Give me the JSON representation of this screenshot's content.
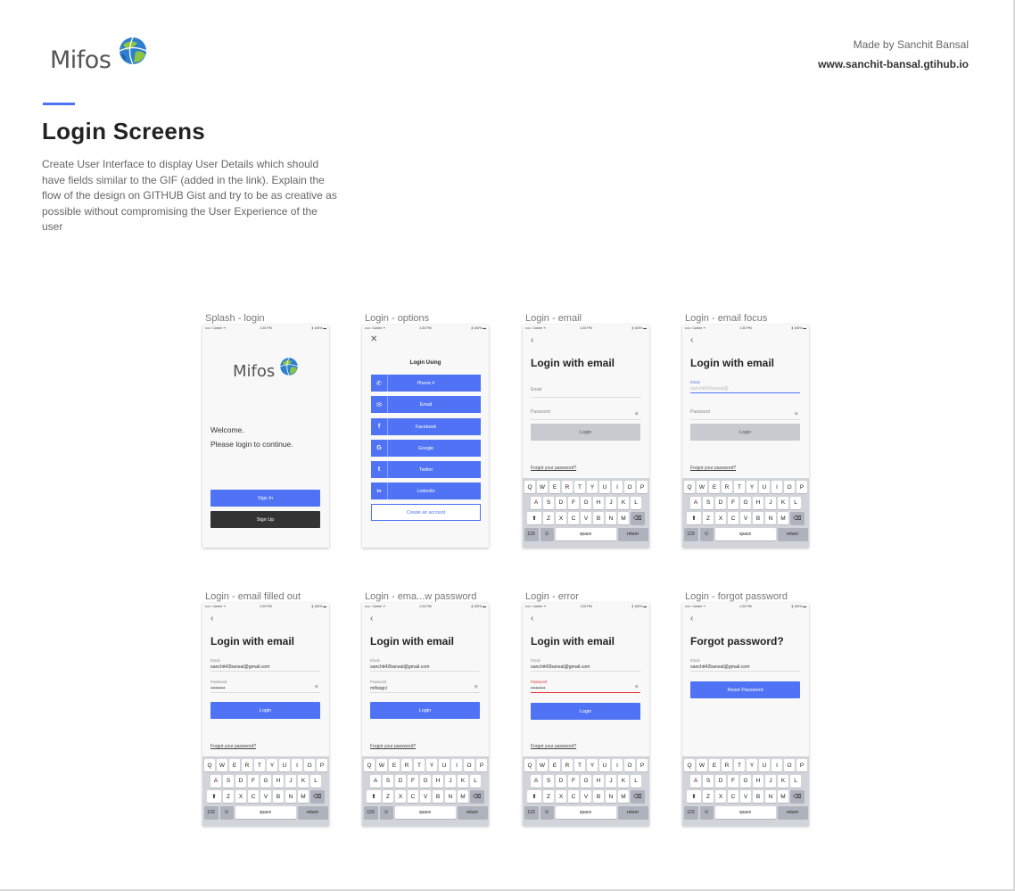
{
  "header": {
    "brand": "Mifos",
    "made_by": "Made by Sanchit Bansal",
    "website": "www.sanchit-bansal.gtihub.io"
  },
  "page_title": "Login Screens",
  "description": "Create User Interface to display User Details which should have fields similar to the GIF (added in the link). Explain the flow of the design on GITHUB Gist and try to be as creative as possible without compromising the User Experience of the user",
  "colors": {
    "accent": "#4f73f4",
    "dark_button": "#333333",
    "error": "#e53935"
  },
  "status_bar": {
    "carrier": "••••○ Carrier ᯤ",
    "time": "1:20 PM",
    "battery": "∦ 100% ▬"
  },
  "keyboard": {
    "row1": [
      "Q",
      "W",
      "E",
      "R",
      "T",
      "Y",
      "U",
      "I",
      "O",
      "P"
    ],
    "row2": [
      "A",
      "S",
      "D",
      "F",
      "G",
      "H",
      "J",
      "K",
      "L"
    ],
    "row3": [
      "Z",
      "X",
      "C",
      "V",
      "B",
      "N",
      "M"
    ],
    "shift": "⬆",
    "backspace": "⌫",
    "numbers": "123",
    "emoji": "☺",
    "space": "space",
    "return": "return"
  },
  "screens": {
    "splash": {
      "label": "Splash - login",
      "brand": "Mifos",
      "welcome_line1": "Welcome.",
      "welcome_line2": "Please login to continue.",
      "sign_in": "Sign In",
      "sign_up": "Sign Up"
    },
    "options": {
      "label": "Login - options",
      "close": "✕",
      "title": "Login Using",
      "buttons": [
        {
          "icon": "phone-icon",
          "glyph": "✆",
          "label": "Phone #"
        },
        {
          "icon": "mail-icon",
          "glyph": "✉",
          "label": "Email"
        },
        {
          "icon": "facebook-icon",
          "glyph": "f",
          "label": "Facebook"
        },
        {
          "icon": "google-icon",
          "glyph": "G",
          "label": "Google"
        },
        {
          "icon": "twitter-icon",
          "glyph": "t",
          "label": "Twitter"
        },
        {
          "icon": "linkedin-icon",
          "glyph": "in",
          "label": "LinkedIn"
        }
      ],
      "create_account": "Create an account"
    },
    "email": {
      "label": "Login - email",
      "back": "‹",
      "title": "Login with email",
      "email_placeholder": "Email",
      "password_placeholder": "Password",
      "login": "Login",
      "forgot": "Forgot your password?"
    },
    "email_focus": {
      "label": "Login - email focus",
      "back": "‹",
      "title": "Login with email",
      "email_label": "Email",
      "email_hint": "sanchit42bansal@",
      "password_placeholder": "Password",
      "login": "Login",
      "forgot": "Forgot your password?"
    },
    "filled": {
      "label": "Login - email filled out",
      "back": "‹",
      "title": "Login with email",
      "email_label": "Email",
      "email_value": "sanchit42bansal@gmail.com",
      "password_label": "Password",
      "password_value": "•••••••••",
      "login": "Login",
      "forgot": "Forgot your password?"
    },
    "show_password": {
      "label": "Login - ema...w password",
      "back": "‹",
      "title": "Login with email",
      "email_label": "Email",
      "email_value": "sanchit42bansal@gmail.com",
      "password_label": "Password",
      "password_value": "mifosgci",
      "login": "Login",
      "forgot": "Forgot your password?"
    },
    "error": {
      "label": "Login - error",
      "back": "‹",
      "title": "Login with email",
      "email_label": "Email",
      "email_value": "sanchit42bansal@gmail.com",
      "password_label": "Password",
      "password_value": "•••••••••",
      "login": "Login",
      "forgot": "Forgot your password?"
    },
    "forgot": {
      "label": "Login - forgot password",
      "back": "‹",
      "title": "Forgot password?",
      "email_label": "Email",
      "email_value": "sanchit42bansal@gmail.com",
      "reset": "Reset Password"
    }
  }
}
